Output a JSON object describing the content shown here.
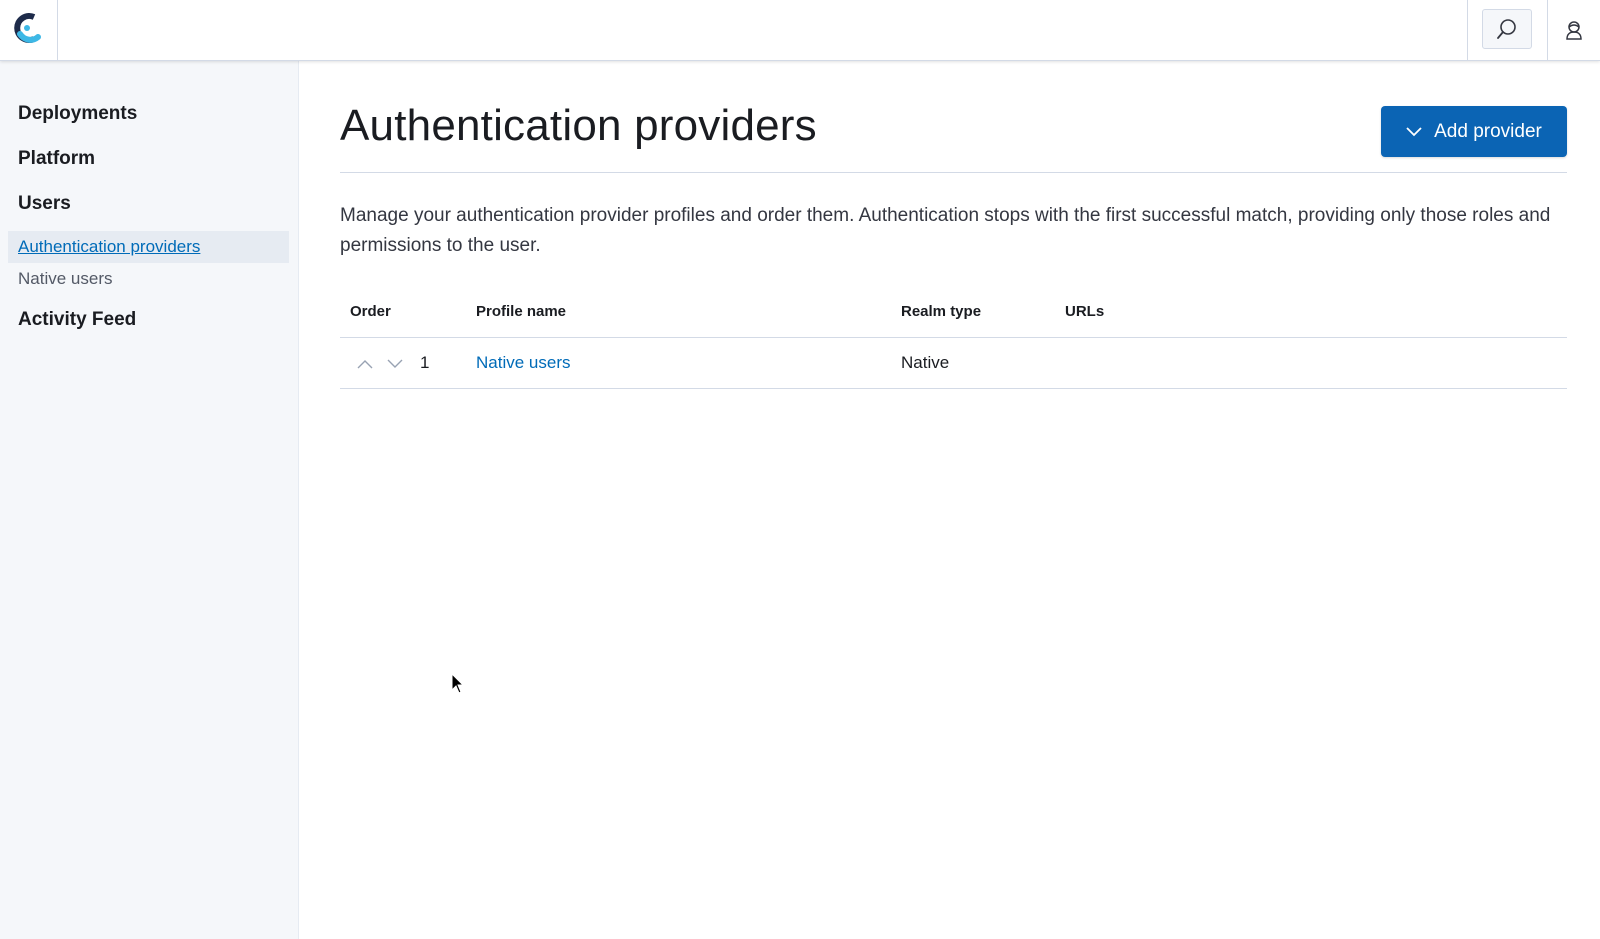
{
  "header": {
    "logo_icon": "elastic-cloud-logo-icon",
    "search_icon": "search-icon",
    "user_icon": "user-icon"
  },
  "sidebar": {
    "sections": [
      {
        "label": "Deployments"
      },
      {
        "label": "Platform"
      },
      {
        "label": "Users"
      }
    ],
    "users_subitems": [
      {
        "label": "Authentication providers",
        "active": true
      },
      {
        "label": "Native users",
        "active": false
      }
    ],
    "activity_feed": "Activity Feed"
  },
  "main": {
    "title": "Authentication providers",
    "add_button_label": "Add provider",
    "description": "Manage your authentication provider profiles and order them. Authentication stops with the first successful match, providing only those roles and permissions to the user.",
    "table": {
      "columns": [
        "Order",
        "Profile name",
        "Realm type",
        "URLs"
      ],
      "rows": [
        {
          "order": "1",
          "profile_name": "Native users",
          "realm_type": "Native",
          "urls": ""
        }
      ]
    }
  },
  "colors": {
    "accent": "#0b64b4",
    "link": "#006bb8",
    "sidebar_bg": "#f5f7fa",
    "border": "#d3dae6"
  }
}
